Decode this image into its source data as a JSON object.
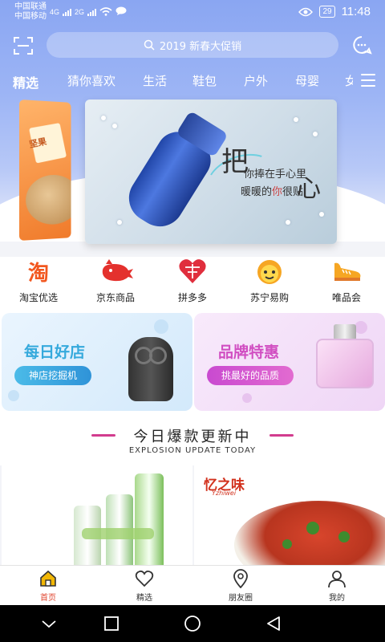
{
  "status_bar": {
    "carrier_1": "中国联通",
    "carrier_2": "中国移动",
    "net_1": "4G",
    "net_2": "2G",
    "battery": "29",
    "time": "11:48"
  },
  "search": {
    "placeholder": "2019 新春大促销"
  },
  "tabs": [
    "精选",
    "猜你喜欢",
    "生活",
    "鞋包",
    "户外",
    "母婴",
    "女"
  ],
  "banner": {
    "big_1": "把",
    "big_2": "心",
    "line_1": "你捧在手心里",
    "line_2a": "暖暖的",
    "line_2b": "你",
    "line_2c": "很贴"
  },
  "side_banner": {
    "label": "坚果"
  },
  "entries": [
    {
      "label": "淘宝优选",
      "icon": "taobao-icon",
      "glyph": "淘"
    },
    {
      "label": "京东商品",
      "icon": "jd-icon",
      "glyph": ""
    },
    {
      "label": "拼多多",
      "icon": "pinduoduo-icon",
      "glyph": ""
    },
    {
      "label": "苏宁易购",
      "icon": "suning-icon",
      "glyph": ""
    },
    {
      "label": "唯品会",
      "icon": "vip-icon",
      "glyph": ""
    }
  ],
  "promos": {
    "left": {
      "title": "每日好店",
      "button": "神店挖掘机"
    },
    "right": {
      "title": "品牌特惠",
      "button": "挑最好的品质"
    }
  },
  "section": {
    "title": "今日爆款更新中",
    "subtitle": "EXPLOSION UPDATE TODAY"
  },
  "products": {
    "right_brand": "忆之味",
    "right_brand_sub": "Yzhiwei"
  },
  "bottom_nav": [
    {
      "label": "首页",
      "icon": "home-icon",
      "active": true
    },
    {
      "label": "精选",
      "icon": "heart-icon",
      "active": false
    },
    {
      "label": "朋友圈",
      "icon": "location-pin-icon",
      "active": false
    },
    {
      "label": "我的",
      "icon": "person-icon",
      "active": false
    }
  ],
  "colors": {
    "accent": "#e0452f",
    "header_blue": "#8aa6f2",
    "pink": "#d14fc2",
    "sky": "#35a9dc"
  }
}
